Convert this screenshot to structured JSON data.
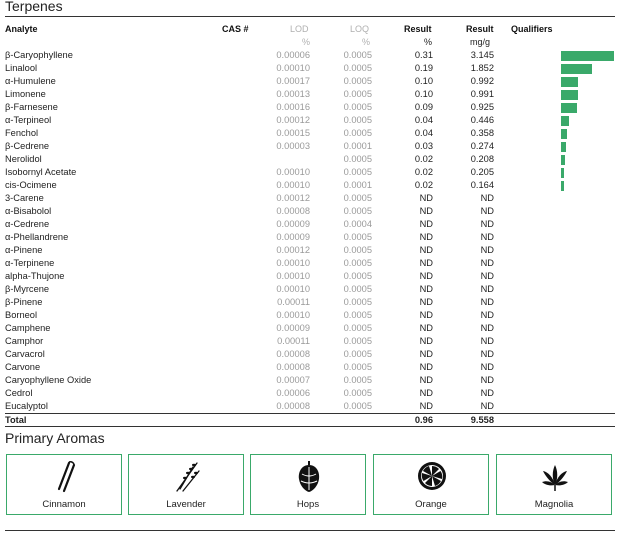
{
  "section_title": "Terpenes",
  "headers": {
    "analyte": "Analyte",
    "cas": "CAS #",
    "lod": "LOD",
    "loq": "LOQ",
    "result_pct": "Result",
    "result_mg": "Result",
    "qualifiers": "Qualifiers"
  },
  "units": {
    "lod": "%",
    "loq": "%",
    "result_pct": "%",
    "result_mg": "mg/g"
  },
  "rows": [
    {
      "name": "β-Caryophyllene",
      "lod": "0.00006",
      "loq": "0.0005",
      "pct": "0.31",
      "mg": "3.145",
      "level": 3.145
    },
    {
      "name": "Linalool",
      "lod": "0.00010",
      "loq": "0.0005",
      "pct": "0.19",
      "mg": "1.852",
      "level": 1.852
    },
    {
      "name": "α-Humulene",
      "lod": "0.00017",
      "loq": "0.0005",
      "pct": "0.10",
      "mg": "0.992",
      "level": 0.992
    },
    {
      "name": "Limonene",
      "lod": "0.00013",
      "loq": "0.0005",
      "pct": "0.10",
      "mg": "0.991",
      "level": 0.991
    },
    {
      "name": "β-Farnesene",
      "lod": "0.00016",
      "loq": "0.0005",
      "pct": "0.09",
      "mg": "0.925",
      "level": 0.925
    },
    {
      "name": "α-Terpineol",
      "lod": "0.00012",
      "loq": "0.0005",
      "pct": "0.04",
      "mg": "0.446",
      "level": 0.446
    },
    {
      "name": "Fenchol",
      "lod": "0.00015",
      "loq": "0.0005",
      "pct": "0.04",
      "mg": "0.358",
      "level": 0.358
    },
    {
      "name": "β-Cedrene",
      "lod": "0.00003",
      "loq": "0.0001",
      "pct": "0.03",
      "mg": "0.274",
      "level": 0.274
    },
    {
      "name": "Nerolidol",
      "lod": "",
      "loq": "0.0005",
      "pct": "0.02",
      "mg": "0.208",
      "level": 0.208
    },
    {
      "name": "Isobornyl Acetate",
      "lod": "0.00010",
      "loq": "0.0005",
      "pct": "0.02",
      "mg": "0.205",
      "level": 0.205
    },
    {
      "name": "cis-Ocimene",
      "lod": "0.00010",
      "loq": "0.0001",
      "pct": "0.02",
      "mg": "0.164",
      "level": 0.164
    },
    {
      "name": "3-Carene",
      "lod": "0.00012",
      "loq": "0.0005",
      "pct": "ND",
      "mg": "ND",
      "level": 0
    },
    {
      "name": "α-Bisabolol",
      "lod": "0.00008",
      "loq": "0.0005",
      "pct": "ND",
      "mg": "ND",
      "level": 0
    },
    {
      "name": "α-Cedrene",
      "lod": "0.00009",
      "loq": "0.0004",
      "pct": "ND",
      "mg": "ND",
      "level": 0
    },
    {
      "name": "α-Phellandrene",
      "lod": "0.00009",
      "loq": "0.0005",
      "pct": "ND",
      "mg": "ND",
      "level": 0
    },
    {
      "name": "α-Pinene",
      "lod": "0.00012",
      "loq": "0.0005",
      "pct": "ND",
      "mg": "ND",
      "level": 0
    },
    {
      "name": "α-Terpinene",
      "lod": "0.00010",
      "loq": "0.0005",
      "pct": "ND",
      "mg": "ND",
      "level": 0
    },
    {
      "name": "alpha-Thujone",
      "lod": "0.00010",
      "loq": "0.0005",
      "pct": "ND",
      "mg": "ND",
      "level": 0
    },
    {
      "name": "β-Myrcene",
      "lod": "0.00010",
      "loq": "0.0005",
      "pct": "ND",
      "mg": "ND",
      "level": 0
    },
    {
      "name": "β-Pinene",
      "lod": "0.00011",
      "loq": "0.0005",
      "pct": "ND",
      "mg": "ND",
      "level": 0
    },
    {
      "name": "Borneol",
      "lod": "0.00010",
      "loq": "0.0005",
      "pct": "ND",
      "mg": "ND",
      "level": 0
    },
    {
      "name": "Camphene",
      "lod": "0.00009",
      "loq": "0.0005",
      "pct": "ND",
      "mg": "ND",
      "level": 0
    },
    {
      "name": "Camphor",
      "lod": "0.00011",
      "loq": "0.0005",
      "pct": "ND",
      "mg": "ND",
      "level": 0
    },
    {
      "name": "Carvacrol",
      "lod": "0.00008",
      "loq": "0.0005",
      "pct": "ND",
      "mg": "ND",
      "level": 0
    },
    {
      "name": "Carvone",
      "lod": "0.00008",
      "loq": "0.0005",
      "pct": "ND",
      "mg": "ND",
      "level": 0
    },
    {
      "name": "Caryophyllene Oxide",
      "lod": "0.00007",
      "loq": "0.0005",
      "pct": "ND",
      "mg": "ND",
      "level": 0
    },
    {
      "name": "Cedrol",
      "lod": "0.00006",
      "loq": "0.0005",
      "pct": "ND",
      "mg": "ND",
      "level": 0
    },
    {
      "name": "Eucalyptol",
      "lod": "0.00008",
      "loq": "0.0005",
      "pct": "ND",
      "mg": "ND",
      "level": 0
    }
  ],
  "total": {
    "label": "Total",
    "pct": "0.96",
    "mg": "9.558"
  },
  "bar_color": "#3aa96a",
  "aromas_title": "Primary Aromas",
  "aromas": [
    {
      "label": "Cinnamon",
      "icon": "cinnamon-icon"
    },
    {
      "label": "Lavender",
      "icon": "lavender-icon"
    },
    {
      "label": "Hops",
      "icon": "hops-icon"
    },
    {
      "label": "Orange",
      "icon": "orange-icon"
    },
    {
      "label": "Magnolia",
      "icon": "magnolia-icon"
    }
  ]
}
